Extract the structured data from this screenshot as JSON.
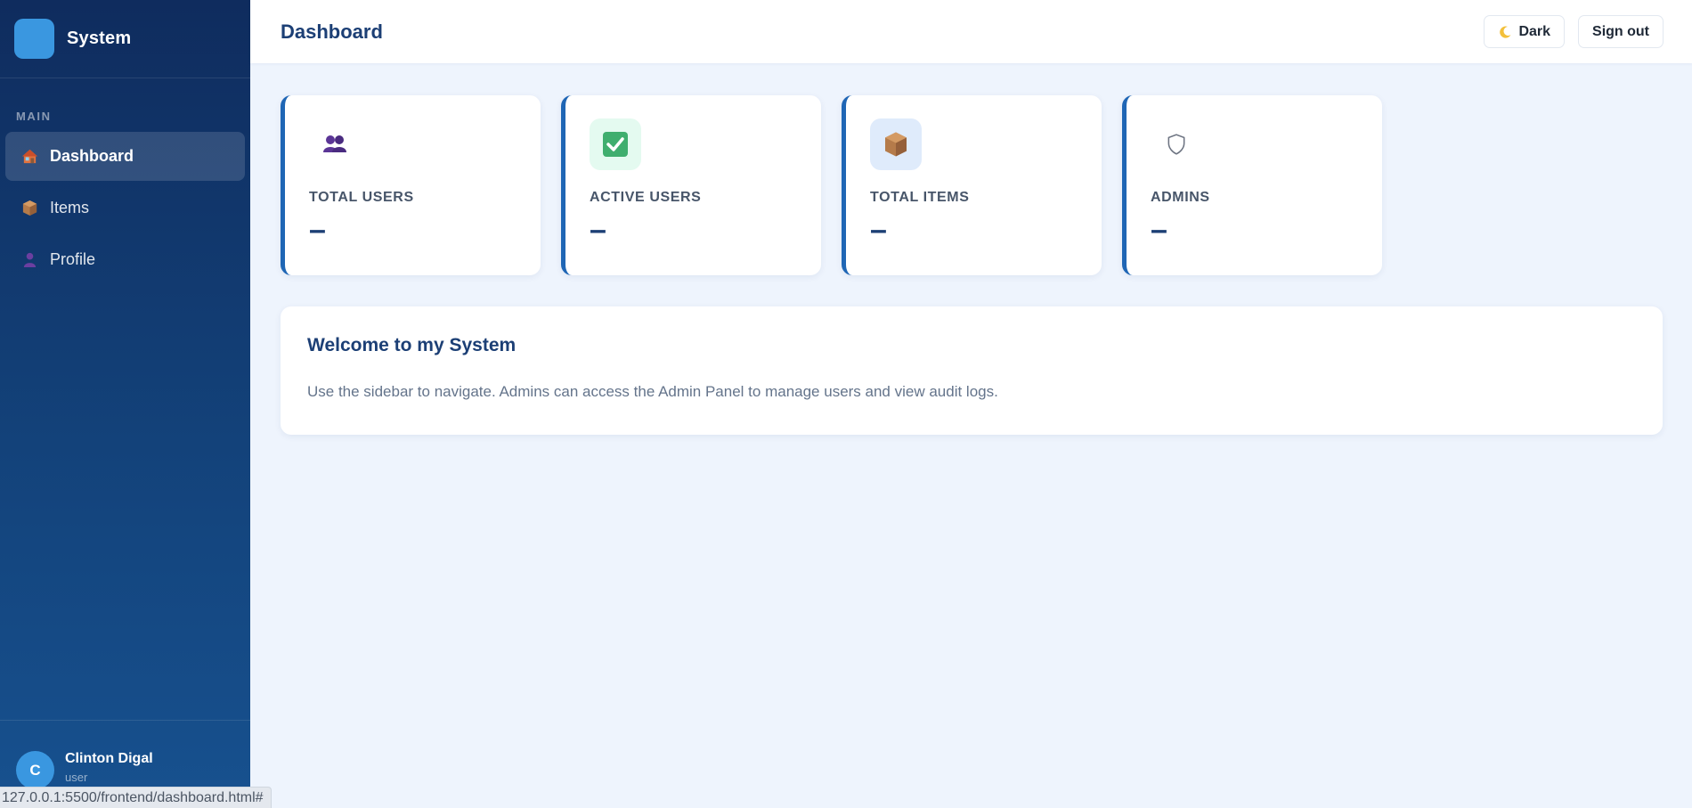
{
  "sidebar": {
    "brand": "System",
    "section_label": "MAIN",
    "items": [
      {
        "label": "Dashboard",
        "icon": "house-icon",
        "active": true
      },
      {
        "label": "Items",
        "icon": "package-icon",
        "active": false
      },
      {
        "label": "Profile",
        "icon": "person-icon",
        "active": false
      }
    ],
    "user": {
      "initial": "C",
      "name": "Clinton Digal",
      "role": "user"
    }
  },
  "topbar": {
    "title": "Dashboard",
    "theme_label": "Dark",
    "signout_label": "Sign out"
  },
  "stats": [
    {
      "label": "TOTAL USERS",
      "value": "–",
      "icon": "users-icon"
    },
    {
      "label": "ACTIVE USERS",
      "value": "–",
      "icon": "check-box-icon"
    },
    {
      "label": "TOTAL ITEMS",
      "value": "–",
      "icon": "package-icon"
    },
    {
      "label": "ADMINS",
      "value": "–",
      "icon": "shield-icon"
    }
  ],
  "welcome": {
    "title": "Welcome to my System",
    "text": "Use the sidebar to navigate. Admins can access the Admin Panel to manage users and view audit logs."
  },
  "status_bar": {
    "url": "127.0.0.1:5500/frontend/dashboard.html#"
  },
  "colors": {
    "sidebar_top": "#0f2c5e",
    "sidebar_bottom": "#17518f",
    "accent": "#1f66b5",
    "brand_blue": "#3a97e0",
    "background": "#eef4fd"
  }
}
